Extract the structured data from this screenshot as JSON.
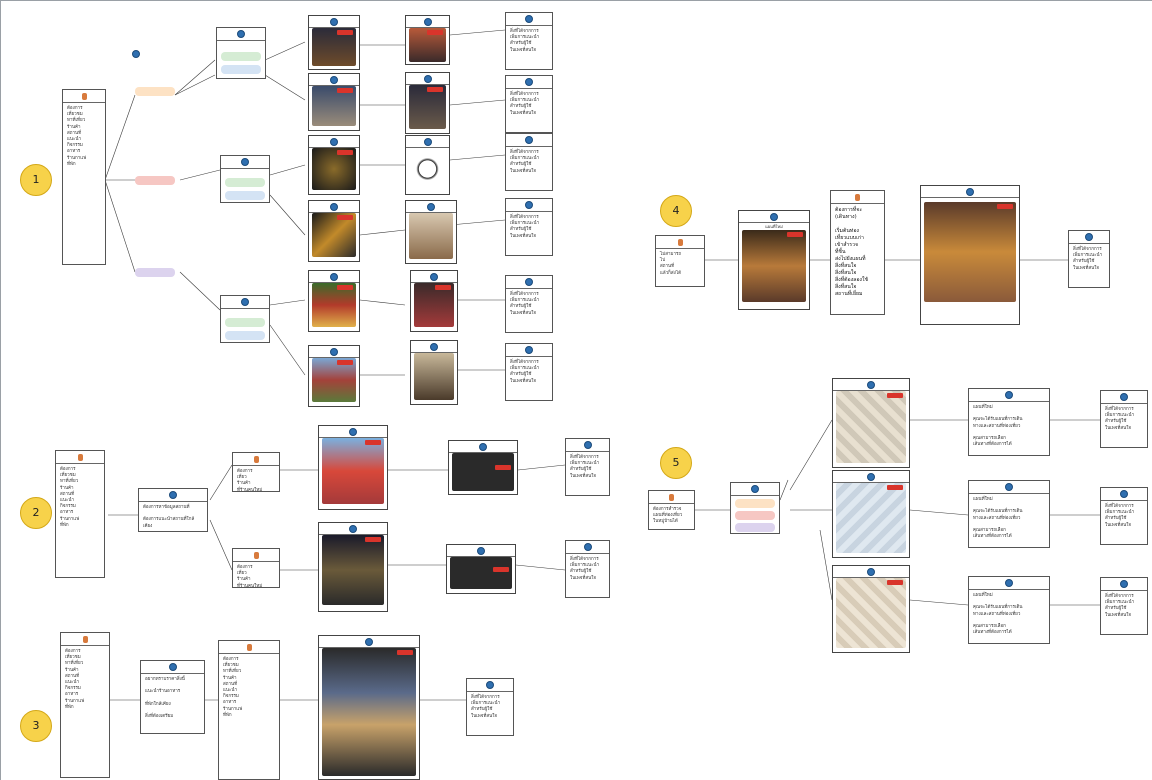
{
  "badges": [
    "1",
    "2",
    "3",
    "4",
    "5"
  ],
  "colors": {
    "badge": "#f7d24a",
    "line": "#3b3b3b",
    "pill_orange": "#fde2c4",
    "pill_green": "#d5ecd4",
    "pill_pink": "#f6c7c3",
    "pill_purple": "#dcd3ee",
    "pill_blue": "#d4e3f4",
    "accent_red": "#d9342b",
    "avatar_blue": "#2f6fb0"
  },
  "icons": [
    "avatar-icon",
    "user-pin-icon"
  ],
  "section4": {
    "user_card": "ไม่สามารถ\nไป\nสถานที่\nแล้วก็ส่งได้",
    "options_card": "ต้องการที่จะ\n(เดินทาง)\n\nเริ่มต้นท่อง\nเที่ยวแบบเก่า\nเข้าสำรวจ\nที่ชิ้น\nส่งไปยังแผนที่\nสิ่งที่สนใจ\nสิ่งที่สนใจ\nสิ่งที่ต้องลองใช้\nสิ่งที่สนใจ\nสถานที่เยี่ยม",
    "photo_caption": "แผนที่ใหม่",
    "final_card": "สิ่งที่ได้จากการ\nเพิ่มการแนะนำ\nสำหรับผู้ใช้\nในเพจที่สนใจ"
  },
  "section5": {
    "user_card": "ต้องการสำรวจ\nแผนที่ท่องเที่ยว\nในหมู่บ้านได้",
    "result_card": "แผนที่ใหม่\n\nคุณจะได้รับแผนที่การเดิน\nทางและสถานที่ท่องเที่ยว\n\nคุณสามารถเลือก\nเส้นทางที่ต้องการได้"
  },
  "section2": {
    "user_card": "ต้องการ\nเที่ยว\nร้านค้า\nที่ร้านคนใหม่\nร้านรองเท้า\nอื่นๆ",
    "bot_card": "ต้องการหาข้อมูลสถานที่\n\nต้องการแนะนำสถานที่ใกล้เคียง"
  },
  "section3": {
    "bot_card": "อยากทราบราคาสิ่งนี้\n\nแนะนำร้านอาหาร\n\nที่พักใกล้เคียง\n\nสิ่งที่ต้องเตรียม"
  },
  "section1": {
    "user_card": "ต้องการ\nเที่ยวชม\nหาที่เที่ยว\nร้านค้า\nสถานที่\nแนะนำ\nกิจกรรม\nอาหาร\nร้านกาแฟ\nที่พัก",
    "result_card": "สิ่งที่ได้จากการ\nเพิ่มการแนะนำ\nสำหรับผู้ใช้\nในเพจที่สนใจ"
  }
}
